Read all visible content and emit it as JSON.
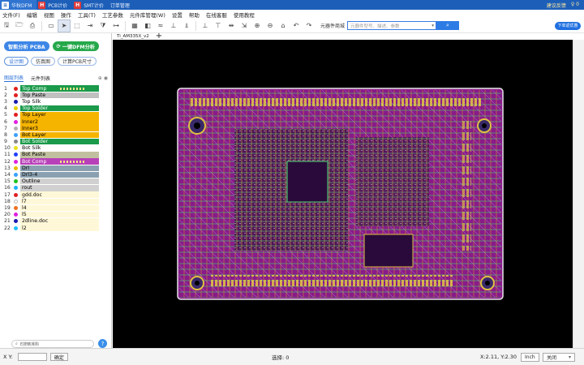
{
  "titlebar": {
    "tabs": [
      {
        "label": "华秋DFM",
        "icon": "dfm-logo-icon",
        "active": true
      },
      {
        "label": "PCB计价",
        "icon": "pcb-quote-icon",
        "active": false
      },
      {
        "label": "SMT计价",
        "icon": "smt-quote-icon",
        "active": false
      },
      {
        "label": "订单管理",
        "icon": "",
        "active": false
      }
    ],
    "feedback": "建议反馈",
    "extra": "♀ 0"
  },
  "menu": [
    "文件(F)",
    "编辑",
    "视图",
    "操作",
    "工具(T)",
    "工艺参数",
    "元件库管理(W)",
    "设置",
    "帮助",
    "在线客服",
    "使用教程"
  ],
  "toolbar": {
    "component_shop_label": "元器件商城",
    "search_placeholder": "元器件型号、描述、参数",
    "vip_label": "下单返优惠"
  },
  "file_tab": "Ti_AM335X_v2",
  "sidebar": {
    "analyze_pcba": "智能分析 PCBA",
    "one_click_dfm": "一键DFM分析",
    "design_view": "设计图",
    "simulation_view": "仿真图",
    "calc_pcb_size": "计算PCB尺寸",
    "tab_layers": "图层列表",
    "tab_components": "元件列表",
    "layers": [
      {
        "num": "1",
        "name": "Top Comp",
        "dot": "#e02020",
        "bg": "#1a9a4a",
        "fg": "#fff",
        "pat": true
      },
      {
        "num": "2",
        "name": "Top Paste",
        "dot": "#e02020",
        "bg": "#c0c0c0",
        "fg": "#000"
      },
      {
        "num": "3",
        "name": "Top Silk",
        "dot": "#1a1ab0",
        "bg": "#fff",
        "fg": "#000"
      },
      {
        "num": "4",
        "name": "Top Solder",
        "dot": "#e8d000",
        "bg": "#1a9a4a",
        "fg": "#fff"
      },
      {
        "num": "5",
        "name": "Top Layer",
        "dot": "#e02020",
        "bg": "#f5b400",
        "fg": "#000"
      },
      {
        "num": "6",
        "name": "Inner2",
        "dot": "#e020e0",
        "bg": "#f5b400",
        "fg": "#000"
      },
      {
        "num": "7",
        "name": "Inner3",
        "dot": "#b0b0b0",
        "bg": "#f5b400",
        "fg": "#000"
      },
      {
        "num": "8",
        "name": "Bot Layer",
        "dot": "#3aa0ff",
        "bg": "#f5b400",
        "fg": "#000"
      },
      {
        "num": "9",
        "name": "Bot Solder",
        "dot": "#888",
        "bg": "#1a9a4a",
        "fg": "#fff"
      },
      {
        "num": "10",
        "name": "Bot Silk",
        "dot": "#e8e020",
        "bg": "#fff",
        "fg": "#000"
      },
      {
        "num": "11",
        "name": "Bot Paste",
        "dot": "#2040ff",
        "bg": "#c0c0a0",
        "fg": "#000"
      },
      {
        "num": "12",
        "name": "Bot Comp",
        "dot": "#e020e0",
        "bg": "#b840b8",
        "fg": "#fff",
        "pat": true
      },
      {
        "num": "13",
        "name": "Drl",
        "dot": "#e8c000",
        "bg": "#8aa0b0",
        "fg": "#000"
      },
      {
        "num": "14",
        "name": "Drl3-4",
        "dot": "#3aa0ff",
        "bg": "#8aa0b0",
        "fg": "#000"
      },
      {
        "num": "15",
        "name": "Outline",
        "dot": "#20c020",
        "bg": "#d0d0d0",
        "fg": "#000"
      },
      {
        "num": "16",
        "name": "rout",
        "dot": "#20b0ff",
        "bg": "#d0d0d0",
        "fg": "#000"
      },
      {
        "num": "17",
        "name": "gdd.doc",
        "dot": "#e02020",
        "bg": "#fff8d8",
        "fg": "#000"
      },
      {
        "num": "18",
        "name": "l7",
        "dot": "#fff",
        "bg": "#fff8d8",
        "fg": "#000"
      },
      {
        "num": "19",
        "name": "l4",
        "dot": "#f07020",
        "bg": "#fff8d8",
        "fg": "#000"
      },
      {
        "num": "20",
        "name": "l5",
        "dot": "#e020e0",
        "bg": "#fff8d8",
        "fg": "#000"
      },
      {
        "num": "21",
        "name": "2dline.doc",
        "dot": "#1a1ab0",
        "bg": "#fff8d8",
        "fg": "#000"
      },
      {
        "num": "22",
        "name": "l2",
        "dot": "#20c0ff",
        "bg": "#fff8d8",
        "fg": "#000"
      }
    ],
    "search_placeholder": "E搜精准购",
    "help_label": "?"
  },
  "statusbar": {
    "xy_label": "X Y:",
    "confirm": "确定",
    "selected": "选择: 0",
    "coords": "X:2.11, Y:2.30",
    "units": "Inch",
    "close": "关闭"
  },
  "colors": {
    "accent": "#1d5fb8",
    "canvas": "#000000",
    "board": "#8a1a8a",
    "board_outline": "#e6e6e6"
  }
}
